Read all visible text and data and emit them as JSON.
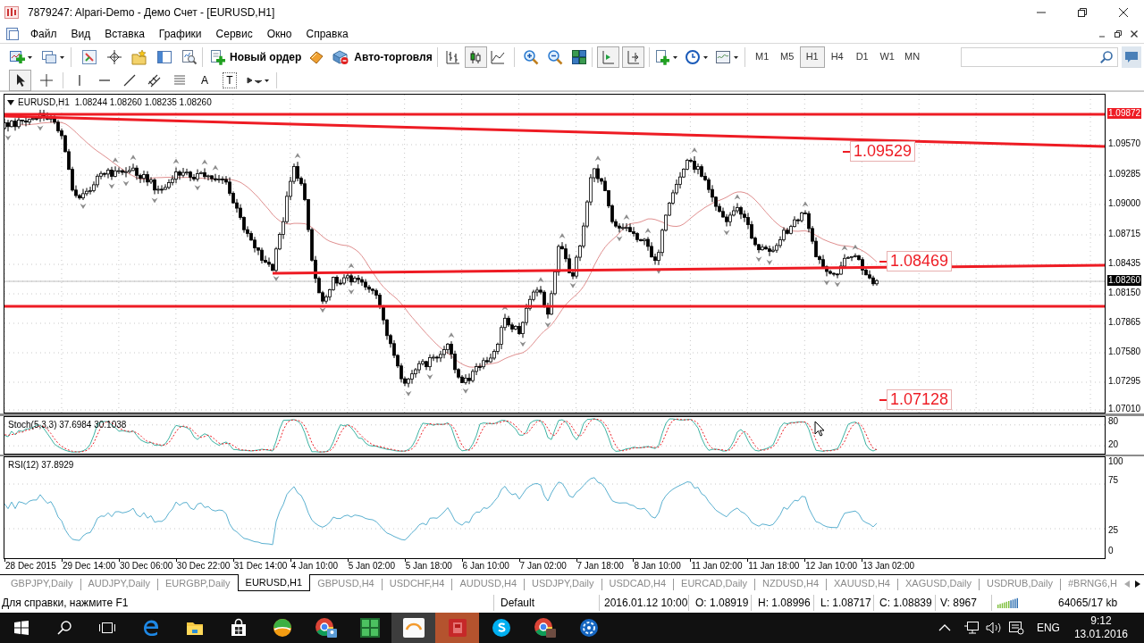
{
  "window": {
    "title": "7879247: Alpari-Demo - Демо Счет - [EURUSD,H1]"
  },
  "menu": [
    "Файл",
    "Вид",
    "Вставка",
    "Графики",
    "Сервис",
    "Окно",
    "Справка"
  ],
  "toolbar": {
    "new_order": "Новый ордер",
    "autotrading": "Авто-торговля",
    "chart_types": [
      {
        "selected": false
      },
      {
        "selected": true
      },
      {
        "selected": false
      }
    ],
    "auto_scroll": {
      "pressed": true
    },
    "chart_shift": {
      "pressed": true
    },
    "timeframes": [
      {
        "label": "M1",
        "selected": false
      },
      {
        "label": "M5",
        "selected": false
      },
      {
        "label": "H1",
        "selected": true
      },
      {
        "label": "H4",
        "selected": false
      },
      {
        "label": "D1",
        "selected": false
      },
      {
        "label": "W1",
        "selected": false
      },
      {
        "label": "MN",
        "selected": false
      }
    ]
  },
  "drawing_toolbar": {
    "cursor": {
      "selected": true
    },
    "crosshair": {
      "selected": false
    },
    "text_tool": "A",
    "text_label_tool": "T"
  },
  "chart": {
    "symbol": "EURUSD,H1",
    "ohlc": "1.08244 1.08260 1.08235 1.08260",
    "price_axis": [
      {
        "text": "1.09872",
        "kind": "line"
      },
      {
        "text": "1.09570",
        "kind": "tick"
      },
      {
        "text": "1.09285",
        "kind": "tick"
      },
      {
        "text": "1.09000",
        "kind": "tick"
      },
      {
        "text": "1.08715",
        "kind": "tick"
      },
      {
        "text": "1.08435",
        "kind": "tick"
      },
      {
        "text": "1.08260",
        "kind": "bid"
      },
      {
        "text": "1.08150",
        "kind": "tick"
      },
      {
        "text": "1.07865",
        "kind": "tick"
      },
      {
        "text": "1.07580",
        "kind": "tick"
      },
      {
        "text": "1.07295",
        "kind": "tick"
      },
      {
        "text": "1.07010",
        "kind": "tick"
      }
    ],
    "price_tags": [
      "1.09529",
      "1.08469",
      "1.07128"
    ],
    "time_axis": [
      "28 Dec 2015",
      "29 Dec 14:00",
      "30 Dec 06:00",
      "30 Dec 22:00",
      "31 Dec 14:00",
      "4 Jan 10:00",
      "5 Jan 02:00",
      "5 Jan 18:00",
      "6 Jan 10:00",
      "7 Jan 02:00",
      "7 Jan 18:00",
      "8 Jan 10:00",
      "11 Jan 02:00",
      "11 Jan 18:00",
      "12 Jan 10:00",
      "13 Jan 02:00"
    ]
  },
  "stochastic": {
    "label": "Stoch(5,3,3) 37.6984 30.1038",
    "axis": [
      "80",
      "20"
    ]
  },
  "rsi": {
    "label": "RSI(12) 37.8929",
    "axis": [
      "100",
      "75",
      "25",
      "0"
    ]
  },
  "tabs": [
    {
      "label": "GBPJPY,Daily",
      "selected": false
    },
    {
      "label": "AUDJPY,Daily",
      "selected": false
    },
    {
      "label": "EURGBP,Daily",
      "selected": false
    },
    {
      "label": "EURUSD,H1",
      "selected": true
    },
    {
      "label": "GBPUSD,H4",
      "selected": false
    },
    {
      "label": "USDCHF,H4",
      "selected": false
    },
    {
      "label": "AUDUSD,H4",
      "selected": false
    },
    {
      "label": "USDJPY,Daily",
      "selected": false
    },
    {
      "label": "USDCAD,H4",
      "selected": false
    },
    {
      "label": "EURCAD,Daily",
      "selected": false
    },
    {
      "label": "NZDUSD,H4",
      "selected": false
    },
    {
      "label": "XAUUSD,H4",
      "selected": false
    },
    {
      "label": "XAGUSD,Daily",
      "selected": false
    },
    {
      "label": "USDRUB,Daily",
      "selected": false
    },
    {
      "label": "#BRNG6,H",
      "selected": false
    }
  ],
  "status_bar": {
    "help": "Для справки, нажмите F1",
    "profile": "Default",
    "datetime": "2016.01.12 10:00",
    "open": "O: 1.08919",
    "high": "H: 1.08996",
    "low": "L: 1.08717",
    "close": "C: 1.08839",
    "volume": "V: 8967",
    "traffic": "64065/17 kb"
  },
  "taskbar": {
    "apps": [
      {
        "active": false,
        "attention": false
      },
      {
        "active": false,
        "attention": false
      },
      {
        "active": false,
        "attention": false
      },
      {
        "active": false,
        "attention": false
      },
      {
        "active": false,
        "attention": false
      },
      {
        "active": false,
        "attention": false
      },
      {
        "active": true,
        "attention": false
      },
      {
        "active": false,
        "attention": true
      },
      {
        "active": false,
        "attention": false
      },
      {
        "active": false,
        "attention": false
      },
      {
        "active": false,
        "attention": false
      }
    ],
    "language": "ENG",
    "time": "9:12",
    "date": "13.01.2016"
  }
}
